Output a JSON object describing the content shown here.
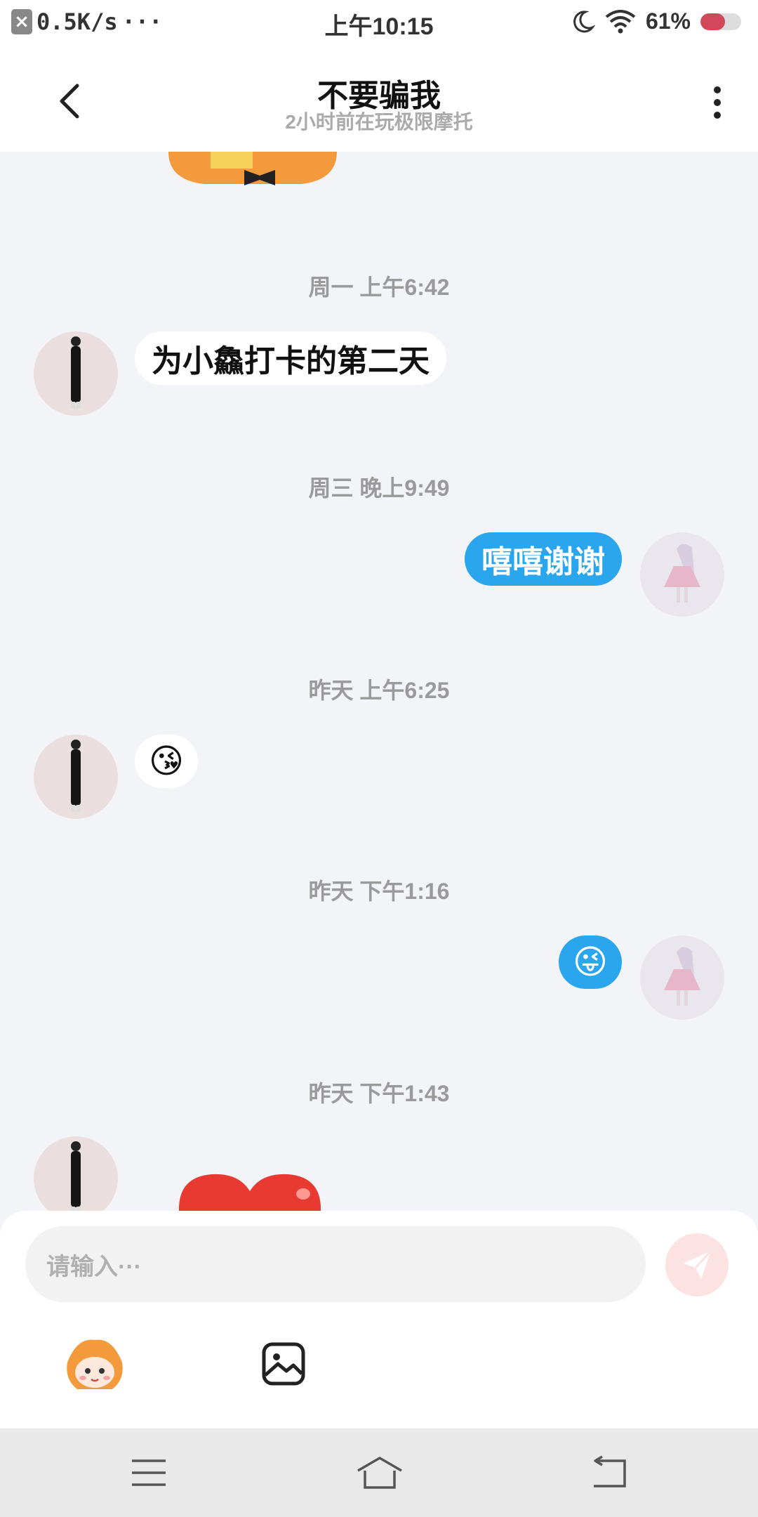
{
  "status_bar": {
    "net_speed": "0.5K/s",
    "dots": "···",
    "time": "上午10:15",
    "battery": "61%",
    "battery_fill": 0.61
  },
  "header": {
    "title": "不要骗我",
    "subtitle": "2小时前在玩极限摩托"
  },
  "chat": {
    "messages": [
      {
        "timestamp": "周一 上午6:42",
        "side": "left",
        "text": "为小鱻打卡的第二天"
      },
      {
        "timestamp": "周三 晚上9:49",
        "side": "right",
        "text": "嘻嘻谢谢"
      },
      {
        "timestamp": "昨天 上午6:25",
        "side": "left",
        "text": "😘"
      },
      {
        "timestamp": "昨天 下午1:16",
        "side": "right",
        "text": "😜"
      },
      {
        "timestamp": "昨天 下午1:43",
        "side": "left",
        "text": ""
      }
    ]
  },
  "input": {
    "placeholder": "请输入···"
  },
  "icons": {
    "back": "back-arrow-icon",
    "more": "more-vertical-icon",
    "send": "send-icon",
    "mascot": "mascot-sticker-icon",
    "image": "image-icon",
    "nav_menu": "menu-icon",
    "nav_home": "home-icon",
    "nav_back": "return-icon"
  },
  "colors": {
    "accent": "#2aa6ee",
    "background": "#f3f4f8",
    "send_disabled": "#fde2e2"
  }
}
